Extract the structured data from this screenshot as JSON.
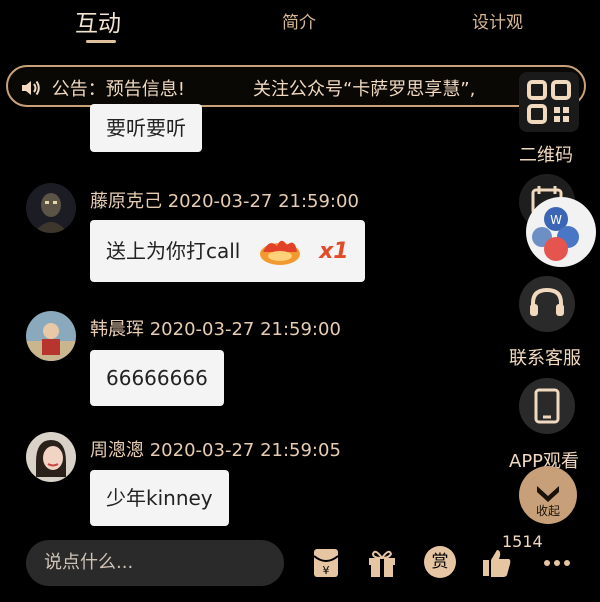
{
  "tabs": [
    {
      "label": "互动",
      "active": true
    },
    {
      "label": "简介",
      "active": false
    },
    {
      "label": "设计观",
      "active": false
    }
  ],
  "announcement": {
    "prefix": "公告：",
    "text_part1": "预告信息!",
    "text_part2": "关注公众号“卡萨罗思享慧”,"
  },
  "messages": [
    {
      "user": "",
      "time": "",
      "text": "要听要听"
    },
    {
      "user": "藤原克己",
      "time": "2020-03-27 21:59:00",
      "text": "送上为你打call",
      "gift_count": "x1"
    },
    {
      "user": "韩晨珲",
      "time": "2020-03-27 21:59:00",
      "text": "66666666"
    },
    {
      "user": "周漗漗",
      "time": "2020-03-27 21:59:05",
      "text": "少年kinney"
    }
  ],
  "side": {
    "qr_label": "二维码",
    "service_label": "联系客服",
    "app_label": "APP观看",
    "collapse_label": "收起"
  },
  "bottom": {
    "placeholder": "说点什么...",
    "reward_label": "赏",
    "likes": "1514"
  },
  "colors": {
    "accent": "#e0c19f",
    "bubble": "#f4f4f4",
    "background": "#000000"
  }
}
